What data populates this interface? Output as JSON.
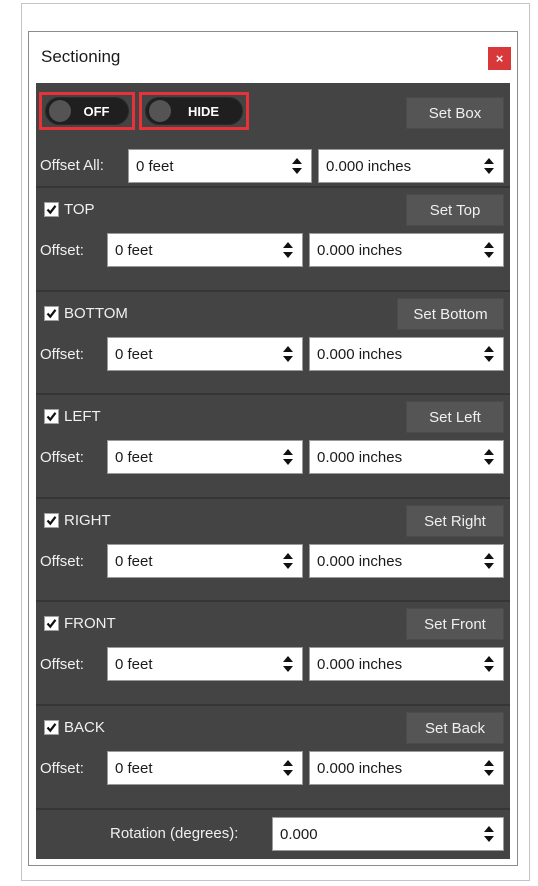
{
  "window": {
    "title": "Sectioning",
    "close_label": "×"
  },
  "top": {
    "off_toggle": "OFF",
    "hide_toggle": "HIDE",
    "set_box": "Set Box",
    "offset_all_label": "Offset All:",
    "offset_all_feet": "0 feet",
    "offset_all_inches": "0.000 inches"
  },
  "sections": [
    {
      "name": "TOP",
      "checked": true,
      "button": "Set Top",
      "offset_label": "Offset:",
      "feet": "0 feet",
      "inches": "0.000 inches"
    },
    {
      "name": "BOTTOM",
      "checked": true,
      "button": "Set Bottom",
      "offset_label": "Offset:",
      "feet": "0 feet",
      "inches": "0.000 inches"
    },
    {
      "name": "LEFT",
      "checked": true,
      "button": "Set Left",
      "offset_label": "Offset:",
      "feet": "0 feet",
      "inches": "0.000 inches"
    },
    {
      "name": "RIGHT",
      "checked": true,
      "button": "Set Right",
      "offset_label": "Offset:",
      "feet": "0 feet",
      "inches": "0.000 inches"
    },
    {
      "name": "FRONT",
      "checked": true,
      "button": "Set Front",
      "offset_label": "Offset:",
      "feet": "0 feet",
      "inches": "0.000 inches"
    },
    {
      "name": "BACK",
      "checked": true,
      "button": "Set Back",
      "offset_label": "Offset:",
      "feet": "0 feet",
      "inches": "0.000 inches"
    }
  ],
  "rotation": {
    "label": "Rotation (degrees):",
    "value": "0.000"
  },
  "colors": {
    "panel_bg": "#444444",
    "highlight": "#e8323a",
    "close_bg": "#d9383a"
  }
}
